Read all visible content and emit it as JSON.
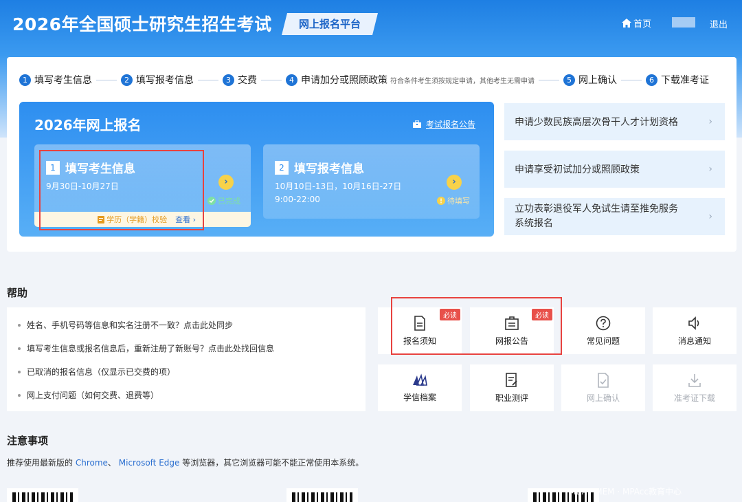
{
  "header": {
    "title": "2026年全国硕士研究生招生考试",
    "platform": "网上报名平台",
    "home": "首页",
    "logout": "退出"
  },
  "steps": [
    {
      "num": "1",
      "label": "填写考生信息"
    },
    {
      "num": "2",
      "label": "填写报考信息"
    },
    {
      "num": "3",
      "label": "交费"
    },
    {
      "num": "4",
      "label": "申请加分或照顾政策",
      "note": "符合条件考生须按规定申请，其他考生无需申请"
    },
    {
      "num": "5",
      "label": "网上确认"
    },
    {
      "num": "6",
      "label": "下载准考证"
    }
  ],
  "main_card": {
    "title": "2026年网上报名",
    "notice_link": "考试报名公告",
    "card1": {
      "num": "1",
      "title": "填写考生信息",
      "date": "9月30日-10月27日",
      "status": "已完成",
      "footer_label": "学历（学籍）校验",
      "footer_link": "查看 ›"
    },
    "card2": {
      "num": "2",
      "title": "填写报考信息",
      "date1": "10月10日-13日，10月16日-27日",
      "date2": "9:00-22:00",
      "status": "待填写"
    }
  },
  "side_items": [
    "申请少数民族高层次骨干人才计划资格",
    "申请享受初试加分或照顾政策",
    "立功表彰退役军人免试生请至推免服务系统报名"
  ],
  "help": {
    "title": "帮助",
    "items": [
      "姓名、手机号码等信息和实名注册不一致？点击此处同步",
      "填写考生信息或报名信息后，重新注册了新账号？点击此处找回信息",
      "已取消的报名信息（仅显示已交费的项）",
      "网上支付问题（如何交费、退费等）"
    ]
  },
  "tiles": [
    {
      "label": "报名须知",
      "badge": "必读",
      "icon": "document-icon"
    },
    {
      "label": "网报公告",
      "badge": "必读",
      "icon": "announcement-icon"
    },
    {
      "label": "常见问题",
      "icon": "question-icon"
    },
    {
      "label": "消息通知",
      "icon": "speaker-icon"
    },
    {
      "label": "学信档案",
      "icon": "archive-icon"
    },
    {
      "label": "职业测评",
      "icon": "assessment-icon"
    },
    {
      "label": "网上确认",
      "icon": "confirm-icon",
      "disabled": true
    },
    {
      "label": "准考证下载",
      "icon": "download-icon",
      "disabled": true
    }
  ],
  "notice": {
    "title": "注意事项",
    "prefix": "推荐使用最新版的",
    "chrome": "Chrome",
    "sep": "、",
    "edge": "Microsoft Edge",
    "suffix": "等浏览器，其它浏览器可能不能正常使用本系统。"
  },
  "watermark": "MBA · MEM · MPAcc教育中心",
  "colors": {
    "primary": "#1f74d6",
    "highlight": "#e8423f",
    "badge": "#e8504a"
  }
}
